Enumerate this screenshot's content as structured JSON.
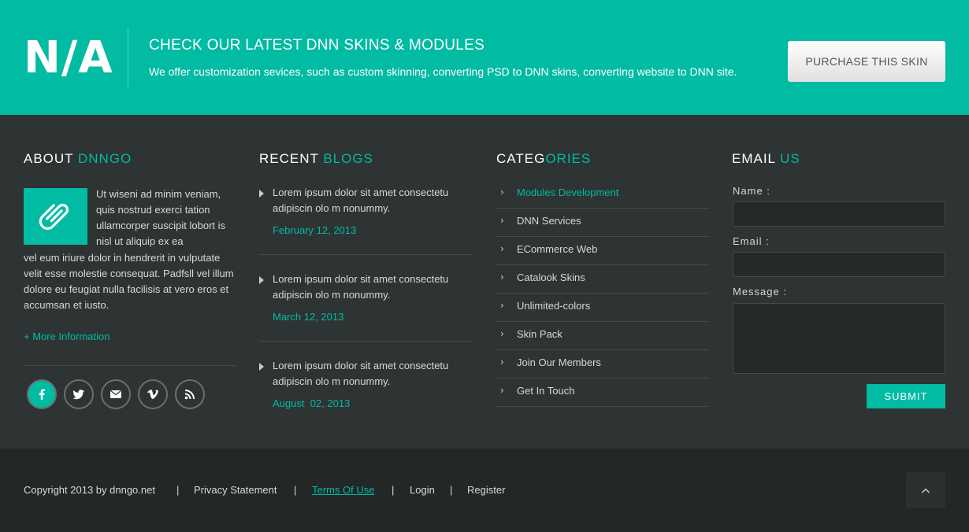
{
  "banner": {
    "logo": "N/A",
    "title": "CHECK OUR LATEST DNN SKINS & MODULES",
    "subtitle": "We offer customization sevices, such as custom skinning, converting PSD to DNN skins, converting website to DNN site.",
    "purchase_label": "PURCHASE THIS SKIN"
  },
  "about": {
    "title_main": "ABOUT ",
    "title_accent": "DNNGO",
    "text_a": "Ut wiseni ad minim veniam, quis nostrud exerci tation ullamcorper suscipit lobort is nisl ut aliquip ex ea",
    "text_b": "vel eum iriure dolor in hendrerit in vulputate velit esse molestie consequat. Padfsll vel illum dolore eu feugiat nulla facilisis at vero eros et accumsan et iusto.",
    "more_label": "+ More Information",
    "social": [
      "facebook-icon",
      "twitter-icon",
      "mail-icon",
      "vimeo-icon",
      "rss-icon"
    ]
  },
  "blogs": {
    "title_main": "RECENT ",
    "title_accent": "BLOGS",
    "items": [
      {
        "text": "Lorem ipsum dolor sit amet consectetu adipiscin olo m nonummy.",
        "date": "February 12, 2013"
      },
      {
        "text": "Lorem ipsum dolor sit amet consectetu adipiscin olo m nonummy.",
        "date": "March 12, 2013"
      },
      {
        "text": "Lorem ipsum dolor sit amet consectetu adipiscin olo m nonummy.",
        "date": "August  02, 2013"
      }
    ]
  },
  "categories": {
    "title_main": "CATEG",
    "title_accent": "ORIES",
    "items": [
      "Modules Development",
      "DNN Services",
      "ECommerce Web",
      "Catalook Skins",
      "Unlimited-colors",
      "Skin Pack",
      "Join Our Members",
      "Get In Touch"
    ]
  },
  "email": {
    "title_main": "EMAIL ",
    "title_accent": "US",
    "name_label": "Name :",
    "email_label": "Email :",
    "message_label": "Message :",
    "name_value": "",
    "email_value": "",
    "message_value": "",
    "submit_label": "SUBMIT"
  },
  "footer": {
    "copyright": "Copyright 2013 by dnngo.net",
    "separator": "|",
    "links": [
      "Privacy Statement",
      "Terms Of Use",
      "Login",
      "Register"
    ],
    "to_top_icon": "chevron-up-icon"
  },
  "colors": {
    "accent": "#01bba3",
    "main_bg": "#2e3333",
    "footer_bg": "#232727"
  }
}
